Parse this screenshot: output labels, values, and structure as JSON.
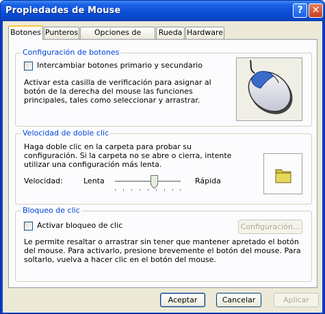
{
  "window": {
    "title": "Propiedades de Mouse",
    "help_glyph": "?",
    "close_glyph": "✕"
  },
  "tabs": [
    {
      "label": "Botones",
      "active": true
    },
    {
      "label": "Punteros",
      "active": false
    },
    {
      "label": "Opciones de puntero",
      "active": false
    },
    {
      "label": "Rueda",
      "active": false
    },
    {
      "label": "Hardware",
      "active": false
    }
  ],
  "button_config": {
    "title": "Configuración de botones",
    "swap_checkbox_label": "Intercambiar botones primario y secundario",
    "swap_checked": false,
    "description": "Activar esta casilla de verificación para asignar al botón de la derecha del mouse las funciones principales, tales como seleccionar y arrastrar."
  },
  "double_click": {
    "title": "Velocidad de doble clic",
    "description": "Haga doble clic en la carpeta para probar su configuración. Si la carpeta no se abre o cierra, intente utilizar una configuración más lenta.",
    "speed_label": "Velocidad:",
    "slow_label": "Lenta",
    "fast_label": "Rápida",
    "slider_fraction": 0.6
  },
  "click_lock": {
    "title": "Bloqueo de clic",
    "checkbox_label": "Activar bloqueo de clic",
    "checked": false,
    "settings_button": "Configuración...",
    "description": "Le permite resaltar o arrastrar sin tener que mantener apretado el botón del mouse. Para activarlo, presione brevemente el botón del mouse. Para soltarlo, vuelva a hacer clic en el botón del mouse."
  },
  "footer": {
    "ok": "Aceptar",
    "cancel": "Cancelar",
    "apply": "Aplicar"
  },
  "icons": {
    "mouse": "mouse-icon",
    "folder": "folder-icon"
  }
}
